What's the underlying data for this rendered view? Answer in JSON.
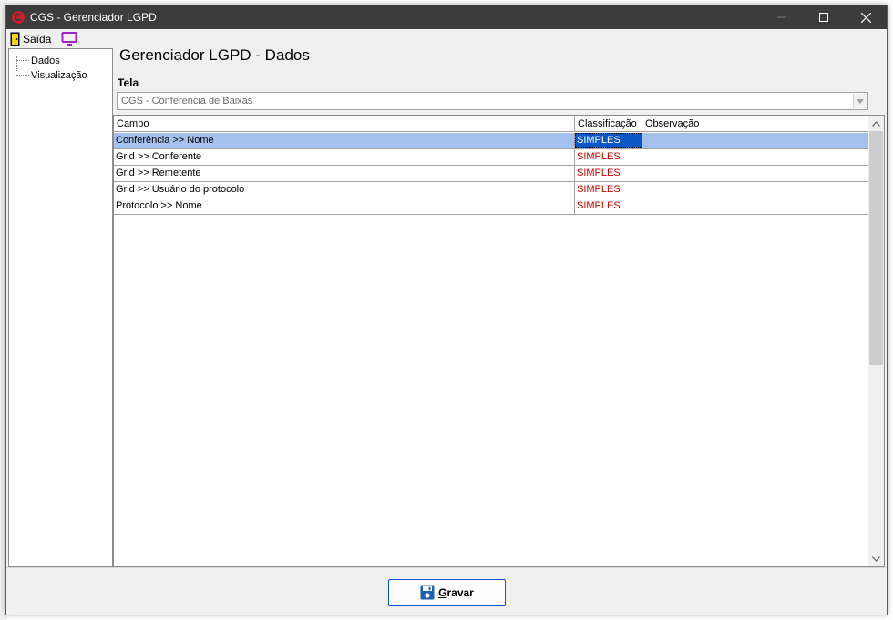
{
  "window": {
    "title": "CGS - Gerenciador LGPD",
    "icon": "cgs-logo-icon",
    "controls": [
      "minimize-icon",
      "maximize-icon",
      "close-icon"
    ]
  },
  "menu": {
    "exit_label": "Saída",
    "exit_icon": "exit-door-icon",
    "screen_icon": "monitor-icon"
  },
  "tree": {
    "items": [
      {
        "label": "Dados"
      },
      {
        "label": "Visualização"
      }
    ]
  },
  "main": {
    "title": "Gerenciador LGPD - Dados",
    "tela_label": "Tela",
    "tela_value": "CGS - Conferencia de Baixas"
  },
  "grid": {
    "columns": [
      "Campo",
      "Classificação",
      "Observação"
    ],
    "rows": [
      {
        "campo": "Conferência >> Nome",
        "classificacao": "SIMPLES",
        "observacao": "",
        "selected": true
      },
      {
        "campo": "Grid >> Conferente",
        "classificacao": "SIMPLES",
        "observacao": ""
      },
      {
        "campo": "Grid >> Remetente",
        "classificacao": "SIMPLES",
        "observacao": ""
      },
      {
        "campo": "Grid >> Usuário do protocolo",
        "classificacao": "SIMPLES",
        "observacao": ""
      },
      {
        "campo": "Protocolo >> Nome",
        "classificacao": "SIMPLES",
        "observacao": ""
      }
    ]
  },
  "footer": {
    "save_label_underlined": "G",
    "save_label_rest": "ravar",
    "save_icon": "floppy-disk-icon"
  },
  "colors": {
    "titlebar": "#3c3c3c",
    "selection": "#a3c1ec",
    "selected_cell": "#0a58c8",
    "classification_text": "#d40000",
    "button_border": "#0b57d0"
  }
}
